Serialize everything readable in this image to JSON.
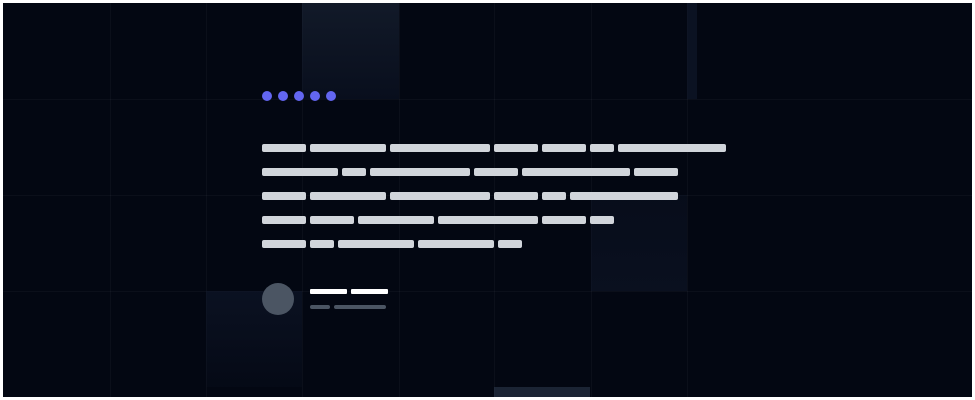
{
  "testimonial": {
    "rating_stars": 5,
    "accent_color": "#6366f1",
    "quote_text_color": "#d1d5db",
    "note": ""
  }
}
